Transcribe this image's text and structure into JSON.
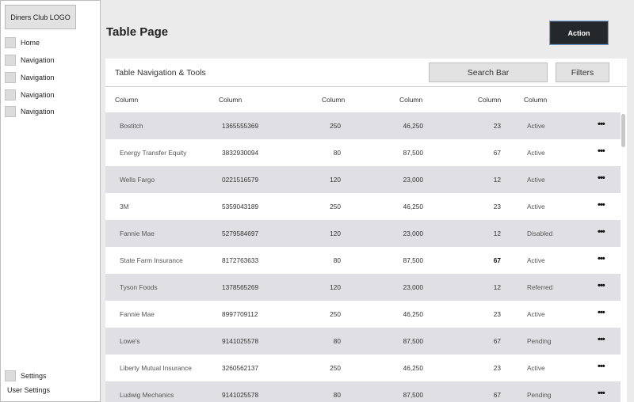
{
  "sidebar": {
    "logo": "Diners Club LOGO",
    "items": [
      {
        "label": "Home"
      },
      {
        "label": "Navigation"
      },
      {
        "label": "Navigation"
      },
      {
        "label": "Navigation"
      },
      {
        "label": "Navigation"
      }
    ],
    "settings_label": "Settings",
    "user_settings_label": "User Settings"
  },
  "header": {
    "title": "Table Page",
    "action_label": "Action"
  },
  "toolbar": {
    "title": "Table Navigation & Tools",
    "search_label": "Search Bar",
    "filters_label": "Filters"
  },
  "table": {
    "columns": [
      "Column",
      "Column",
      "Column",
      "Column",
      "Column",
      "Column"
    ],
    "rows": [
      {
        "name": "Bostitch",
        "number": "1365555369",
        "qty": "250",
        "amount": "46,250",
        "count": "23",
        "status": "Active"
      },
      {
        "name": "Energy Transfer Equity",
        "number": "3832930094",
        "qty": "80",
        "amount": "87,500",
        "count": "67",
        "status": "Active"
      },
      {
        "name": "Wells Fargo",
        "number": "0221516579",
        "qty": "120",
        "amount": "23,000",
        "count": "12",
        "status": "Active"
      },
      {
        "name": "3M",
        "number": "5359043189",
        "qty": "250",
        "amount": "46,250",
        "count": "23",
        "status": "Active"
      },
      {
        "name": "Fannie Mae",
        "number": "5279584697",
        "qty": "120",
        "amount": "23,000",
        "count": "12",
        "status": "Disabled"
      },
      {
        "name": "State Farm Insurance",
        "number": "8172763633",
        "qty": "80",
        "amount": "87,500",
        "count": "67",
        "status": "Active"
      },
      {
        "name": "Tyson Foods",
        "number": "1378565269",
        "qty": "120",
        "amount": "23,000",
        "count": "12",
        "status": "Referred"
      },
      {
        "name": "Fannie Mae",
        "number": "8997709112",
        "qty": "250",
        "amount": "46,250",
        "count": "23",
        "status": "Active"
      },
      {
        "name": "Lowe's",
        "number": "9141025578",
        "qty": "80",
        "amount": "87,500",
        "count": "67",
        "status": "Pending"
      },
      {
        "name": "Liberty Mutual Insurance",
        "number": "3260562137",
        "qty": "250",
        "amount": "46,250",
        "count": "23",
        "status": "Active"
      },
      {
        "name": "Ludwig Mechanics",
        "number": "9141025578",
        "qty": "80",
        "amount": "87,500",
        "count": "67",
        "status": "Pending"
      }
    ],
    "row_menu_glyph": "•••"
  },
  "colors": {
    "action_bg": "#25282b",
    "row_shade": "#e0e0e4",
    "page_bg": "#ebebeb"
  }
}
